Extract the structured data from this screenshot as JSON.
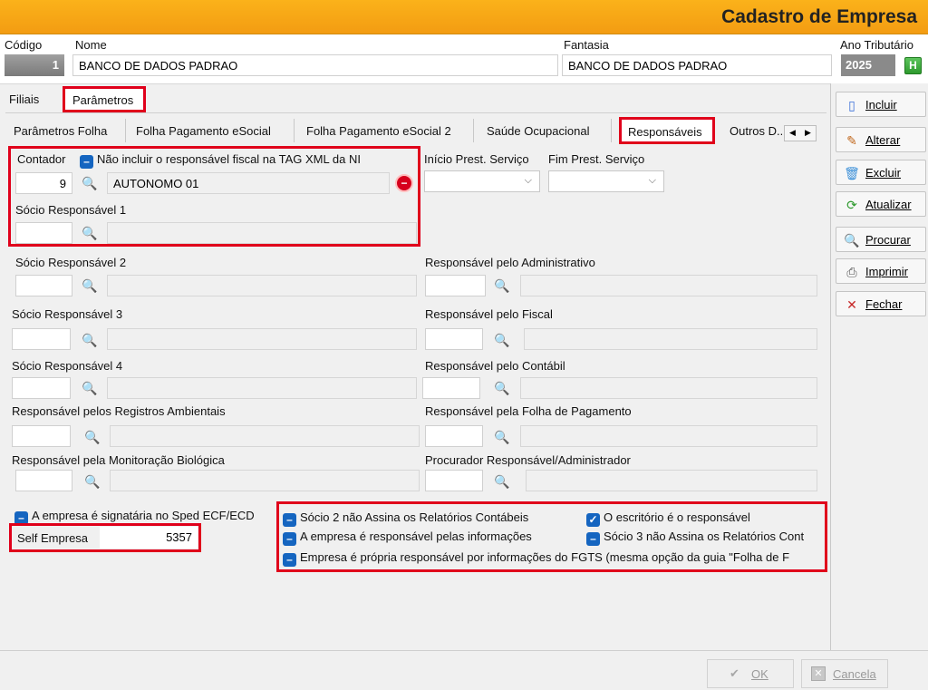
{
  "window": {
    "title": "Cadastro de Empresa"
  },
  "header": {
    "codigo_label": "Código",
    "codigo_value": "1",
    "nome_label": "Nome",
    "nome_value": "BANCO DE DADOS PADRAO",
    "fantasia_label": "Fantasia",
    "fantasia_value": "BANCO DE DADOS PADRAO",
    "ano_label": "Ano Tributário",
    "ano_value": "2025",
    "ano_button": "H"
  },
  "main_tabs": [
    "Filiais",
    "Parâmetros"
  ],
  "sub_tabs": [
    "Parâmetros Folha",
    "Folha Pagamento eSocial",
    "Folha Pagamento eSocial 2",
    "Saúde Ocupacional",
    "Responsáveis",
    "Outros D..."
  ],
  "contador": {
    "label": "Contador",
    "checkbox_label": "Não incluir o responsável fiscal na TAG XML da NI",
    "code": "9",
    "name": "AUTONOMO 01"
  },
  "prest": {
    "inicio_label": "Início Prest. Serviço",
    "fim_label": "Fim Prest. Serviço"
  },
  "left_fields": [
    {
      "label": "Sócio Responsável 1"
    },
    {
      "label": "Sócio Responsável 2"
    },
    {
      "label": "Sócio Responsável 3"
    },
    {
      "label": "Sócio Responsável 4"
    },
    {
      "label": "Responsável pelos Registros Ambientais"
    },
    {
      "label": "Responsável pela Monitoração Biológica"
    }
  ],
  "right_fields": [
    {
      "label": "Responsável pelo Administrativo"
    },
    {
      "label": "Responsável pelo Fiscal"
    },
    {
      "label": "Responsável pelo Contábil"
    },
    {
      "label": "Responsável pela Folha de Pagamento"
    },
    {
      "label": "Procurador Responsável/Administrador"
    }
  ],
  "options": {
    "sped": "A empresa é signatária no Sped ECF/ECD",
    "self_empresa_label": "Self Empresa",
    "self_empresa_value": "5357",
    "socio2": "Sócio 2 não Assina os Relatórios Contábeis",
    "escritorio": "O escritório é o responsável",
    "empresa_resp": "A empresa é responsável pelas informações",
    "socio3": "Sócio 3 não Assina os Relatórios Cont",
    "fgts": "Empresa é própria responsável por informações do FGTS (mesma opção da guia \"Folha de F"
  },
  "side_buttons": [
    "Incluir",
    "Alterar",
    "Excluir",
    "Atualizar",
    "Procurar",
    "Imprimir",
    "Fechar"
  ],
  "footer": {
    "ok": "OK",
    "cancel": "Cancela"
  }
}
